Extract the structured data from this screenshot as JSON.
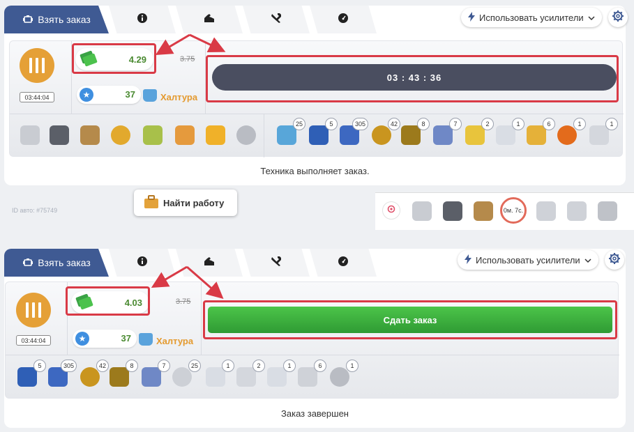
{
  "tabs": {
    "take_order": "Взять заказ",
    "info_icon": "info-icon",
    "strength_icon": "strength-icon",
    "tools_icon": "tools-icon",
    "speed_icon": "speedometer-icon"
  },
  "boost_label": "Использовать усилители",
  "top_order": {
    "time": "03:44:04",
    "money": "4.29",
    "old_money": "3.75",
    "stars": "37",
    "haltura": "Халтура",
    "timer": "03 : 43 : 36",
    "status": "Техника выполняет заказ.",
    "equipment": [
      "chair-icon",
      "robot-icon",
      "hourglass-icon",
      "gear-coin-icon",
      "can-icon",
      "jar-icon",
      "horn-icon",
      "wheel-icon"
    ],
    "bonus_items": [
      {
        "name": "boat-icon",
        "count": "25"
      },
      {
        "name": "bottles-icon",
        "count": "5"
      },
      {
        "name": "bottles-pack-icon",
        "count": "305"
      },
      {
        "name": "medal-icon",
        "count": "42"
      },
      {
        "name": "badge-icon",
        "count": "8"
      },
      {
        "name": "drill-icon",
        "count": "7"
      },
      {
        "name": "jar-icon",
        "count": "2"
      },
      {
        "name": "can-icon",
        "count": "1"
      },
      {
        "name": "syringe-icon",
        "count": "6"
      },
      {
        "name": "orb-icon",
        "count": "1"
      },
      {
        "name": "lamp-icon",
        "count": "1"
      }
    ]
  },
  "middle": {
    "id_auto": "ID авто: #75749",
    "find_work": "Найти работу",
    "timer_circle": "0м. 7с."
  },
  "bottom_order": {
    "time": "03:44:04",
    "money": "4.03",
    "old_money": "3.75",
    "stars": "37",
    "haltura": "Халтура",
    "submit": "Сдать заказ",
    "status": "Заказ завершен",
    "bonus_items": [
      {
        "name": "bottles-icon",
        "count": "5"
      },
      {
        "name": "bottles-pack-icon",
        "count": "305"
      },
      {
        "name": "medal-icon",
        "count": "42"
      },
      {
        "name": "badge-icon",
        "count": "8"
      },
      {
        "name": "drill-icon",
        "count": "7"
      },
      {
        "name": "tire-icon",
        "count": "25"
      },
      {
        "name": "jar-icon",
        "count": "1"
      },
      {
        "name": "can-icon",
        "count": "2"
      },
      {
        "name": "tank-icon",
        "count": "1"
      },
      {
        "name": "syringe-icon",
        "count": "6"
      },
      {
        "name": "wheel-icon",
        "count": "1"
      }
    ]
  },
  "colors": {
    "accent_blue": "#3f5a93",
    "orange": "#e5a037",
    "green_value": "#4a8a31",
    "highlight_red": "#d93a46",
    "submit_green": "#3aae3c"
  }
}
